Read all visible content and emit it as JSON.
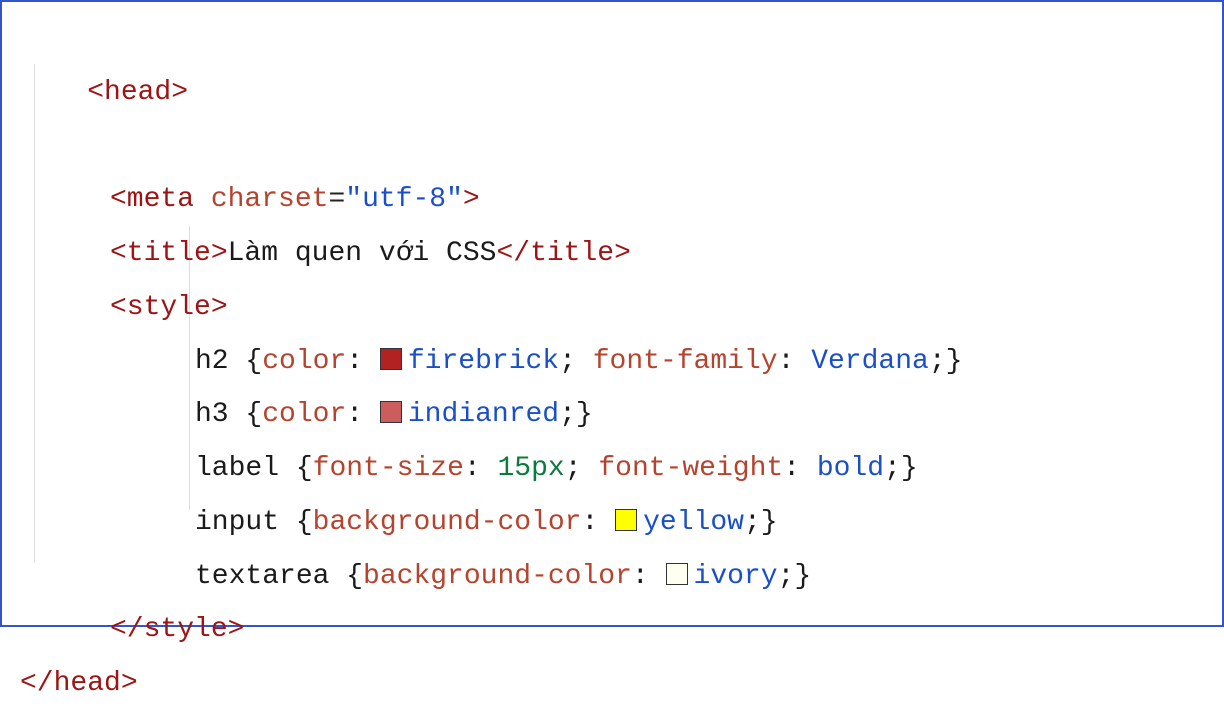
{
  "code": {
    "line1_tag_open": "<head>",
    "line2_tag": "<meta",
    "line2_attr": "charset",
    "line2_eq": "=",
    "line2_val": "\"utf-8\"",
    "line2_close": ">",
    "line3_open": "<title>",
    "line3_text": "Làm quen với CSS",
    "line3_close": "</title>",
    "line4_open": "<style>",
    "rule1_sel": "h2 ",
    "rule1_brace_open": "{",
    "rule1_prop1": "color",
    "rule1_val1": "firebrick",
    "rule1_prop2": "font-family",
    "rule1_val2": "Verdana",
    "rule1_brace_close": "}",
    "rule2_sel": "h3 ",
    "rule2_brace_open": "{",
    "rule2_prop1": "color",
    "rule2_val1": "indianred",
    "rule2_brace_close": "}",
    "rule3_sel": "label ",
    "rule3_brace_open": "{",
    "rule3_prop1": "font-size",
    "rule3_val1": "15px",
    "rule3_prop2": "font-weight",
    "rule3_val2": "bold",
    "rule3_brace_close": "}",
    "rule4_sel": "input ",
    "rule4_brace_open": "{",
    "rule4_prop1": "background-color",
    "rule4_val1": "yellow",
    "rule4_brace_close": "}",
    "rule5_sel": "textarea ",
    "rule5_brace_open": "{",
    "rule5_prop1": "background-color",
    "rule5_val1": "ivory",
    "rule5_brace_close": "}",
    "line10_close": "</style>",
    "line11_close": "</head>",
    "colon": ":",
    "semi": ";",
    "space": " "
  }
}
